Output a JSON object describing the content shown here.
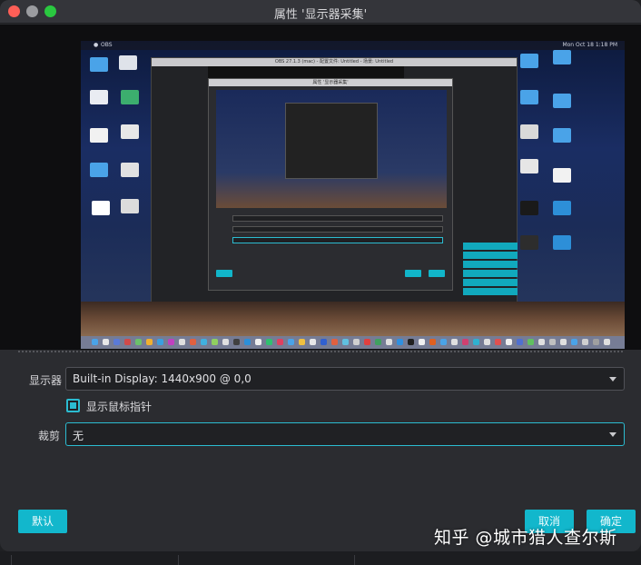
{
  "window": {
    "title": "属性 '显示器采集'"
  },
  "preview": {
    "menubar": {
      "app": "OBS",
      "clock": "Mon Oct 18  1:18 PM"
    },
    "obs_window_title": "OBS 27.1.3 (mac) - 配置文件: Untitled - 场景: Untitled",
    "inner_dialog_title": "属性 '显示器采集'"
  },
  "form": {
    "display_label": "显示器",
    "display_value": "Built-in Display: 1440x900 @ 0,0",
    "show_cursor_label": "显示鼠标指针",
    "show_cursor_checked": true,
    "crop_label": "裁剪",
    "crop_value": "无"
  },
  "buttons": {
    "default": "默认",
    "cancel": "取消",
    "ok": "确定"
  },
  "watermark": "知乎 @城市猎人查尔斯",
  "colors": {
    "accent": "#12b7cc",
    "background": "#2b2c30",
    "field": "#202124"
  }
}
